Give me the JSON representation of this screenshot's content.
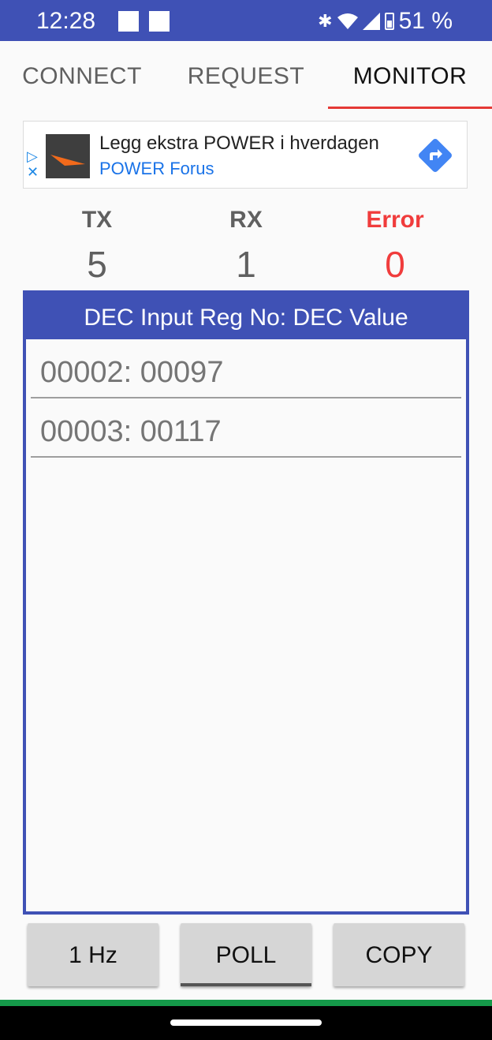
{
  "status_bar": {
    "time": "12:28",
    "battery": "51 %",
    "icons": [
      "bluetooth-icon",
      "wifi-icon",
      "signal-icon",
      "battery-icon"
    ]
  },
  "tabs": [
    {
      "label": "CONNECT",
      "active": false
    },
    {
      "label": "REQUEST",
      "active": false
    },
    {
      "label": "MONITOR",
      "active": true
    }
  ],
  "ad": {
    "title": "Legg ekstra POWER i hverdagen",
    "subtitle": "POWER Forus"
  },
  "counters": {
    "tx": {
      "label": "TX",
      "value": "5"
    },
    "rx": {
      "label": "RX",
      "value": "1"
    },
    "error": {
      "label": "Error",
      "value": "0"
    }
  },
  "panel": {
    "header": "DEC Input Reg No: DEC Value",
    "rows": [
      "00002: 00097",
      "00003: 00117"
    ]
  },
  "buttons": {
    "rate": "1 Hz",
    "poll": "POLL",
    "copy": "COPY"
  },
  "colors": {
    "primary": "#3f51b5",
    "accent": "#e53935",
    "error": "#f03c3c",
    "nav_green": "#159a4a"
  }
}
